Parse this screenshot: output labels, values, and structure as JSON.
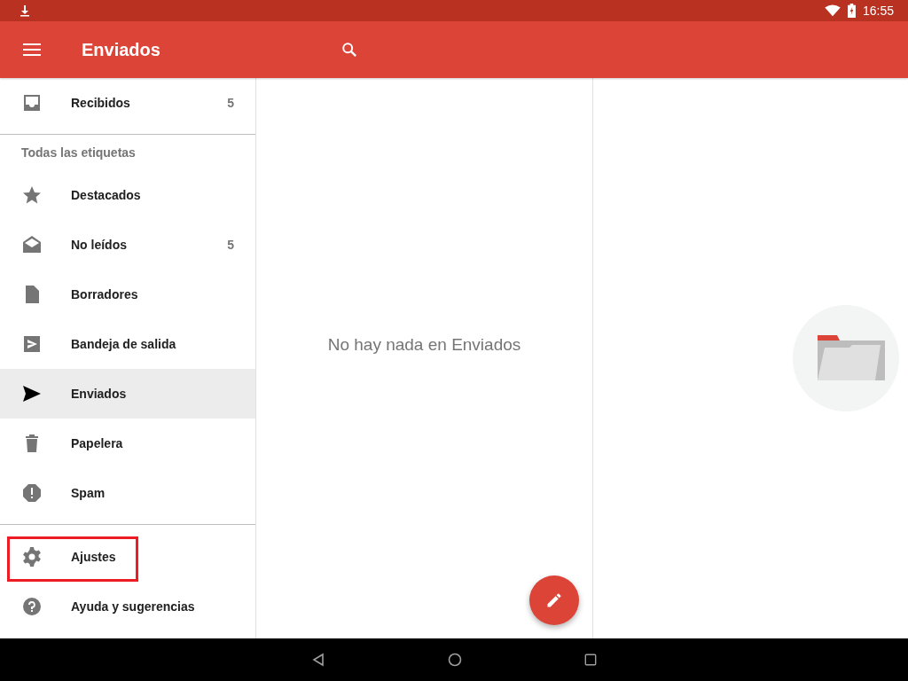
{
  "status_bar": {
    "time": "16:55"
  },
  "app_bar": {
    "title": "Enviados"
  },
  "drawer": {
    "sections": [
      {
        "items": [
          {
            "label": "Recibidos",
            "count": "5",
            "selected": false,
            "annotated": false
          }
        ]
      },
      {
        "header": "Todas las etiquetas",
        "items": [
          {
            "label": "Destacados",
            "selected": false,
            "annotated": false
          },
          {
            "label": "No leídos",
            "count": "5",
            "selected": false,
            "annotated": false
          },
          {
            "label": "Borradores",
            "selected": false,
            "annotated": false
          },
          {
            "label": "Bandeja de salida",
            "selected": false,
            "annotated": false
          },
          {
            "label": "Enviados",
            "selected": true,
            "annotated": false
          },
          {
            "label": "Papelera",
            "selected": false,
            "annotated": false
          },
          {
            "label": "Spam",
            "selected": false,
            "annotated": false
          }
        ]
      },
      {
        "items": [
          {
            "label": "Ajustes",
            "selected": false,
            "annotated": true
          },
          {
            "label": "Ayuda y sugerencias",
            "selected": false,
            "annotated": false
          }
        ]
      }
    ]
  },
  "list": {
    "empty_message": "No hay nada en Enviados"
  }
}
